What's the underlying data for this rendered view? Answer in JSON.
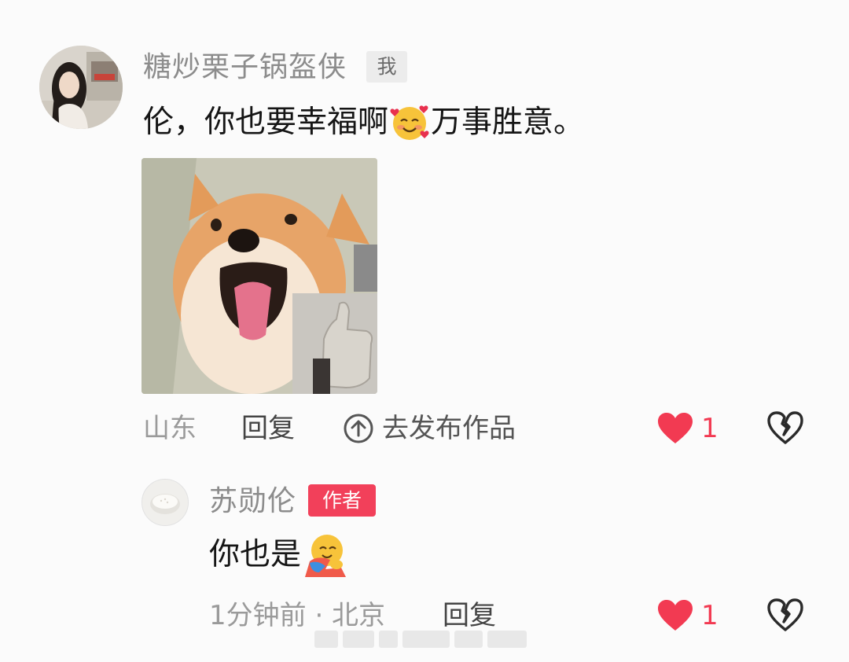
{
  "comment": {
    "username": "糖炒栗子锅盔侠",
    "me_tag": "我",
    "text_before_emoji": "伦，你也要幸福啊",
    "emoji": "smiling-face-with-hearts-icon",
    "text_after_emoji": "万事胜意。",
    "sticker": "shiba-dog-thumbs-up-sticker",
    "location": "山东",
    "reply_label": "回复",
    "publish_label": "去发布作品",
    "like_count": "1"
  },
  "reply": {
    "username": "苏勋伦",
    "author_tag": "作者",
    "text": "你也是",
    "emoji": "hugging-face-icon",
    "time_location": "1分钟前 · 北京",
    "reply_label": "回复",
    "like_count": "1"
  },
  "colors": {
    "like": "#f23a52",
    "author_tag": "#f2405a",
    "meta_text": "#9a9a9a"
  }
}
